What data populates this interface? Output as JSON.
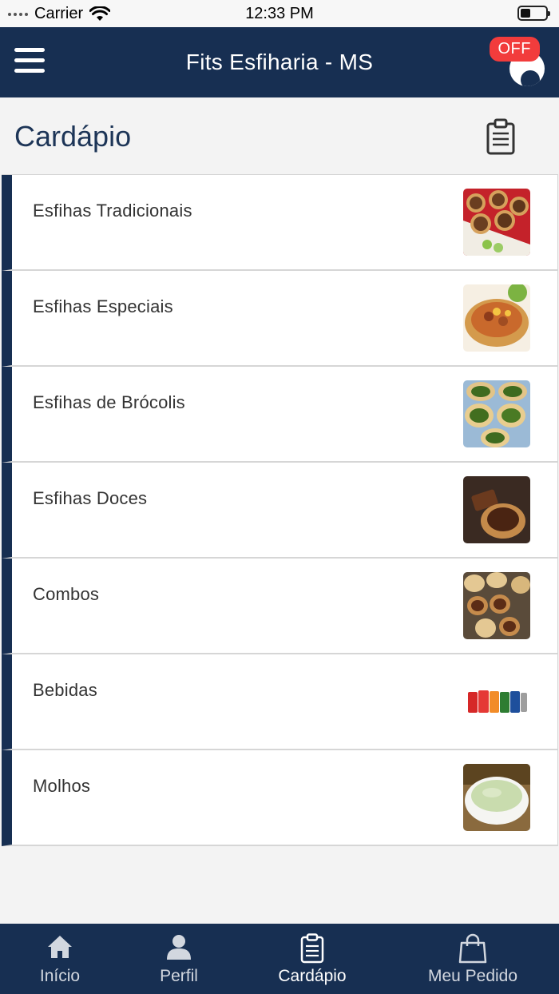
{
  "status_bar": {
    "carrier": "Carrier",
    "time": "12:33 PM"
  },
  "nav": {
    "title": "Fits Esfiharia - MS",
    "status_badge": "OFF"
  },
  "page": {
    "title": "Cardápio"
  },
  "menu": {
    "items": [
      {
        "label": "Esfihas Tradicionais",
        "image": "meat-esfihas-photo"
      },
      {
        "label": "Esfihas Especiais",
        "image": "special-esfiha-photo"
      },
      {
        "label": "Esfihas de Brócolis",
        "image": "broccoli-esfihas-photo"
      },
      {
        "label": "Esfihas Doces",
        "image": "sweet-esfiha-photo"
      },
      {
        "label": "Combos",
        "image": "combo-esfihas-photo"
      },
      {
        "label": "Bebidas",
        "image": "soda-cans-photo"
      },
      {
        "label": "Molhos",
        "image": "sauce-bowl-photo"
      }
    ]
  },
  "tabs": [
    {
      "label": "Início",
      "icon": "home-icon",
      "active": false
    },
    {
      "label": "Perfil",
      "icon": "person-icon",
      "active": false
    },
    {
      "label": "Cardápio",
      "icon": "clipboard-icon",
      "active": true
    },
    {
      "label": "Meu Pedido",
      "icon": "shopping-bag-icon",
      "active": false
    }
  ],
  "colors": {
    "primary": "#172f52",
    "badge": "#f23c3c",
    "background": "#f3f3f3"
  }
}
